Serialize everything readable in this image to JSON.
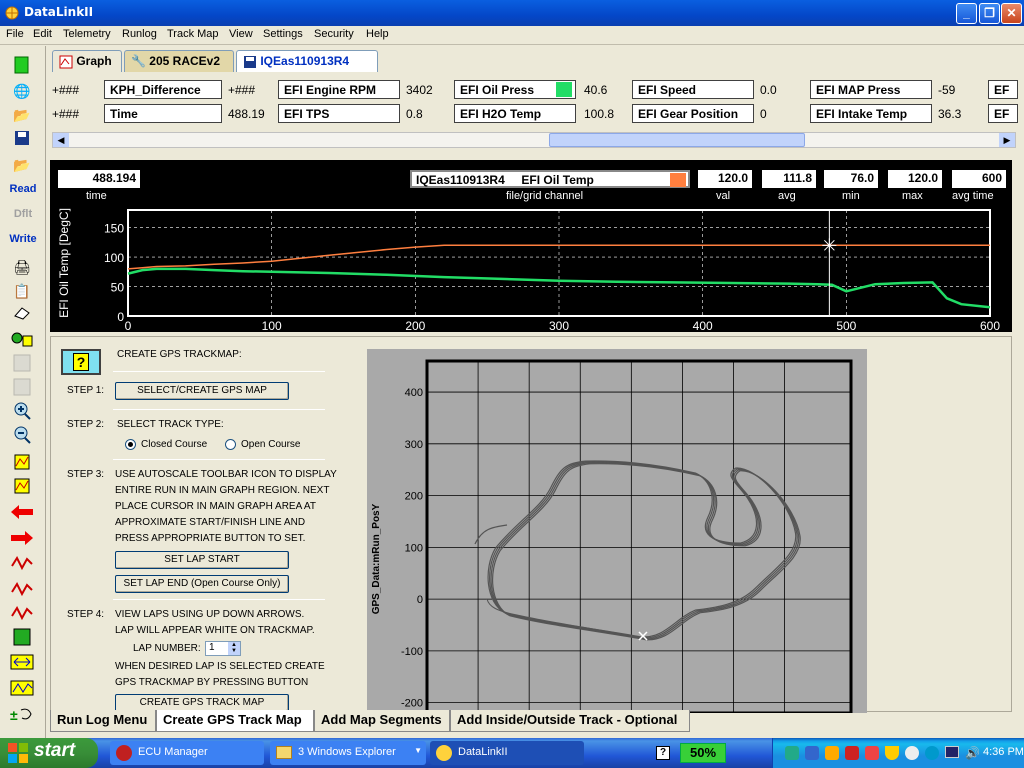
{
  "window": {
    "title": "DataLinkII"
  },
  "menu": [
    "File",
    "Edit",
    "Telemetry",
    "Runlog",
    "Track Map",
    "View",
    "Settings",
    "Security",
    "Help"
  ],
  "toolbar": {
    "read": "Read",
    "dflt": "Dflt",
    "write": "Write"
  },
  "tabs": [
    {
      "label": "Graph"
    },
    {
      "label": "205 RACEv2"
    },
    {
      "label": "IQEas110913R4"
    }
  ],
  "channels_row1": [
    {
      "prefix": "+###",
      "name": "KPH_Difference",
      "value": ""
    },
    {
      "prefix": "+###",
      "name": "EFI Engine RPM",
      "value": "3402"
    },
    {
      "prefix": "",
      "name": "EFI Oil Press",
      "value": "40.6"
    },
    {
      "prefix": "",
      "name": "EFI Speed",
      "value": "0.0"
    },
    {
      "prefix": "",
      "name": "EFI MAP Press",
      "value": "-59"
    },
    {
      "prefix": "",
      "name": "EF",
      "value": ""
    }
  ],
  "channels_row2": [
    {
      "prefix": "+###",
      "name": "Time",
      "value": "488.19"
    },
    {
      "prefix": "",
      "name": "EFI TPS",
      "value": "0.8"
    },
    {
      "prefix": "",
      "name": "EFI H2O Temp",
      "value": "100.8"
    },
    {
      "prefix": "",
      "name": "EFI Gear Position",
      "value": "0"
    },
    {
      "prefix": "",
      "name": "EFI Intake Temp",
      "value": "36.3"
    },
    {
      "prefix": "",
      "name": "EF",
      "value": ""
    }
  ],
  "graph_header": {
    "time_value": "488.194",
    "time_label": "time",
    "file": "IQEas110913R4",
    "channel": "EFI Oil Temp",
    "file_label": "file/grid channel",
    "val": "120.0",
    "avg": "111.8",
    "min": "76.0",
    "max": "120.0",
    "avgtime": "600",
    "val_label": "val",
    "avg_label": "avg",
    "min_label": "min",
    "max_label": "max",
    "avgtime_label": "avg time"
  },
  "chart_data": [
    {
      "type": "line",
      "ylabel": "EFI Oil Temp [DegC]",
      "xlim": [
        0,
        600
      ],
      "ylim": [
        0,
        180
      ],
      "xticks": [
        0,
        100,
        200,
        300,
        400,
        500,
        600
      ],
      "yticks": [
        0,
        50,
        100,
        150
      ],
      "cursor_x": 488.19,
      "series": [
        {
          "color": "#ff7f3f",
          "x": [
            0,
            10,
            20,
            40,
            60,
            80,
            100,
            120,
            140,
            160,
            180,
            200,
            220,
            240,
            300,
            400,
            488,
            500,
            600
          ],
          "y": [
            80,
            82,
            84,
            85,
            88,
            90,
            93,
            98,
            103,
            108,
            113,
            117,
            120,
            120,
            120,
            120,
            120,
            120,
            120
          ]
        },
        {
          "color": "#22dd66",
          "x": [
            0,
            10,
            20,
            40,
            60,
            80,
            100,
            140,
            180,
            220,
            260,
            300,
            340,
            380,
            420,
            460,
            480,
            490,
            500,
            520,
            540,
            560,
            570,
            580,
            600
          ],
          "y": [
            72,
            78,
            80,
            80,
            78,
            76,
            75,
            73,
            70,
            66,
            63,
            60,
            58,
            57,
            56,
            55,
            54,
            53,
            42,
            54,
            56,
            57,
            30,
            20,
            15
          ]
        }
      ]
    },
    {
      "type": "line",
      "ylabel": "GPS_Data:mRun_PosY",
      "ylim": [
        -220,
        460
      ],
      "yticks": [
        400,
        300,
        200,
        100,
        0,
        -100,
        -200
      ]
    }
  ],
  "gps_panel": {
    "title": "CREATE GPS TRACKMAP:",
    "step1": "STEP 1:",
    "step1_btn": "SELECT/CREATE  GPS MAP",
    "step2": "STEP 2:",
    "step2_text": "SELECT TRACK TYPE:",
    "closed": "Closed Course",
    "open": "Open Course",
    "step3": "STEP 3:",
    "step3_lines": [
      "USE AUTOSCALE TOOLBAR ICON TO DISPLAY",
      "ENTIRE RUN IN MAIN GRAPH REGION. NEXT",
      "PLACE CURSOR IN MAIN GRAPH AREA AT",
      "APPROXIMATE START/FINISH LINE  AND",
      "PRESS APPROPRIATE BUTTON TO SET."
    ],
    "lap_start": "SET LAP START",
    "lap_end": "SET LAP END (Open Course Only)",
    "step4": "STEP 4:",
    "step4_lines": [
      "VIEW LAPS USING UP DOWN ARROWS.",
      "LAP WILL APPEAR WHITE ON TRACKMAP."
    ],
    "lap_number_label": "LAP NUMBER:",
    "lap_number": "1",
    "step4_lines2": [
      "WHEN DESIRED LAP IS SELECTED CREATE",
      "GPS TRACKMAP BY PRESSING BUTTON"
    ],
    "create_btn": "CREATE GPS TRACK MAP"
  },
  "bottom_tabs": [
    "Run Log Menu",
    "Create GPS Track Map",
    "Add Map Segments",
    "Add Inside/Outside Track - Optional"
  ],
  "taskbar": {
    "start": "start",
    "items": [
      "ECU Manager",
      "3 Windows Explorer",
      "DataLinkII"
    ],
    "battery": "50%",
    "clock": "4:36 PM"
  },
  "colors": {
    "accent": "#0a5fe0",
    "oil_press_indicator": "#22dd66",
    "oil_temp_indicator": "#ff7f3f"
  }
}
